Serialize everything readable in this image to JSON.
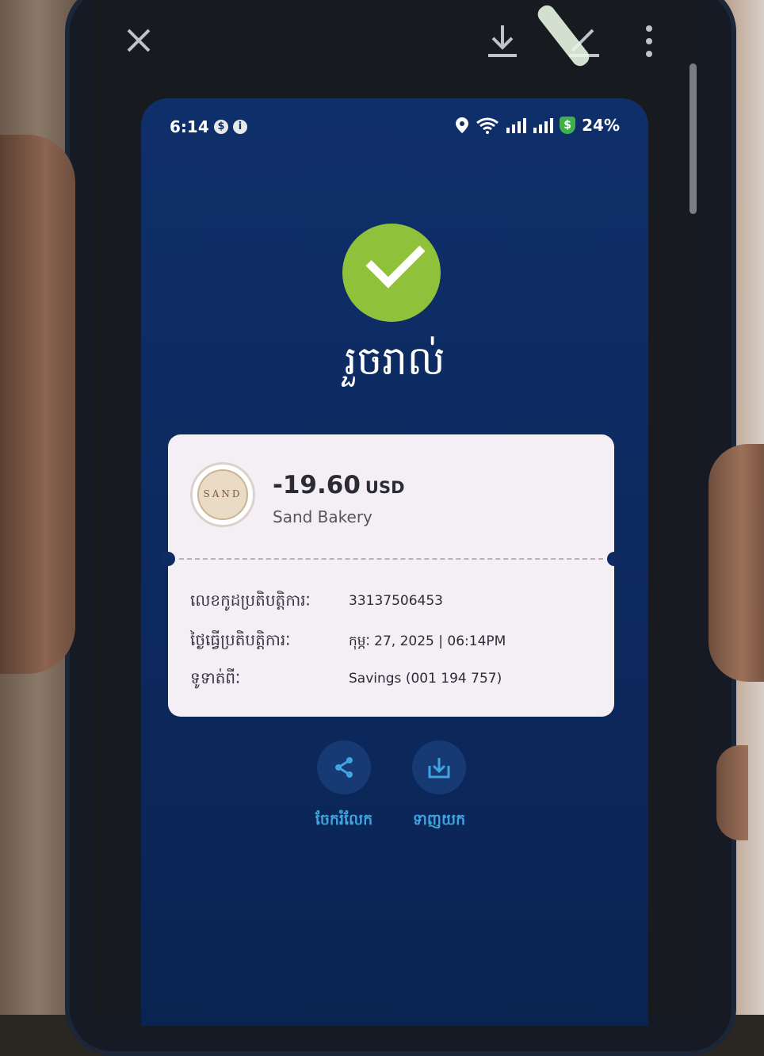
{
  "viewer": {
    "close_icon": "close-icon",
    "download_icon": "download-icon",
    "edit_icon": "edit-icon",
    "more_icon": "more-vert-icon"
  },
  "status_bar": {
    "time": "6:14",
    "notif_1": "$",
    "notif_2": "i",
    "battery": "24%",
    "shield_symbol": "$"
  },
  "receipt": {
    "title": "រួចរាល់",
    "amount": "-19.60",
    "currency": "USD",
    "merchant": "Sand Bakery",
    "logo_text": "SAND",
    "rows": [
      {
        "label": "លេខកូដប្រតិបត្តិការៈ",
        "value": "33137506453"
      },
      {
        "label": "ថ្ងៃធ្វើប្រតិបត្តិការៈ",
        "value": "កុម្ភៈ 27, 2025 | 06:14PM"
      },
      {
        "label": "ទូទាត់ពីៈ",
        "value": "Savings (001 194 757)"
      }
    ]
  },
  "actions": {
    "share_label": "ចែករំលែក",
    "download_label": "ទាញយក"
  },
  "colors": {
    "accent_green": "#8fc23a",
    "background_blue": "#0f2f6b",
    "action_text": "#3fa4e0"
  }
}
